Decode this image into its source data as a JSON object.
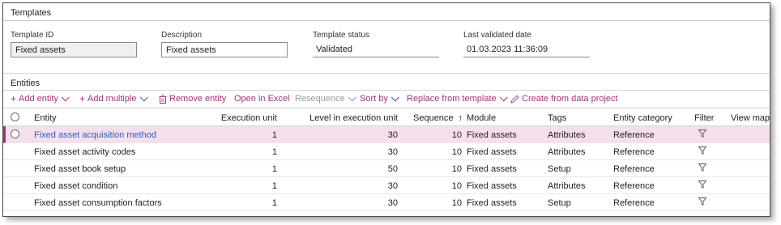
{
  "templates": {
    "section_title": "Templates",
    "template_id": {
      "label": "Template ID",
      "value": "Fixed assets"
    },
    "description": {
      "label": "Description",
      "value": "Fixed assets"
    },
    "template_status": {
      "label": "Template status",
      "value": "Validated"
    },
    "last_validated": {
      "label": "Last validated date",
      "value": "01.03.2023 11:36:09"
    }
  },
  "entities": {
    "section_title": "Entities",
    "toolbar": {
      "add_entity": "Add entity",
      "add_multiple": "Add multiple",
      "remove_entity": "Remove entity",
      "open_in_excel": "Open in Excel",
      "resequence": "Resequence",
      "sort_by": "Sort by",
      "replace_from_template": "Replace from template",
      "create_from_data_project": "Create from data project"
    },
    "columns": {
      "entity": "Entity",
      "execution_unit": "Execution unit",
      "level": "Level in execution unit",
      "sequence": "Sequence",
      "module": "Module",
      "tags": "Tags",
      "entity_category": "Entity category",
      "filter": "Filter",
      "view_map": "View map"
    },
    "sort_indicator": "↑",
    "rows": [
      {
        "entity": "Fixed asset acquisition method",
        "execution_unit": "1",
        "level": "30",
        "sequence": "10",
        "module": "Fixed assets",
        "tags": "Attributes",
        "category": "Reference"
      },
      {
        "entity": "Fixed asset activity codes",
        "execution_unit": "1",
        "level": "30",
        "sequence": "10",
        "module": "Fixed assets",
        "tags": "Attributes",
        "category": "Reference"
      },
      {
        "entity": "Fixed asset book setup",
        "execution_unit": "1",
        "level": "50",
        "sequence": "10",
        "module": "Fixed assets",
        "tags": "Setup",
        "category": "Reference"
      },
      {
        "entity": "Fixed asset condition",
        "execution_unit": "1",
        "level": "30",
        "sequence": "10",
        "module": "Fixed assets",
        "tags": "Attributes",
        "category": "Reference"
      },
      {
        "entity": "Fixed asset consumption factors",
        "execution_unit": "1",
        "level": "30",
        "sequence": "10",
        "module": "Fixed assets",
        "tags": "Setup",
        "category": "Reference"
      }
    ],
    "selected_row": 0
  },
  "colors": {
    "accent": "#a4327a",
    "link": "#2b5fb4",
    "selected_row_bg": "#f6dfec"
  }
}
